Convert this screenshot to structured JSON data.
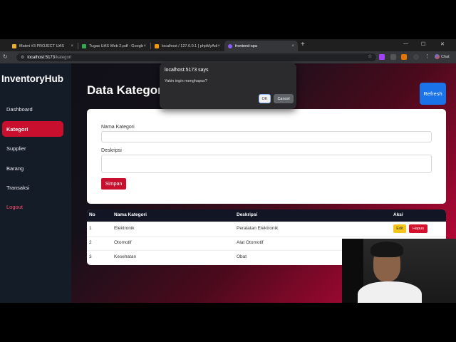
{
  "browser": {
    "tabs": [
      {
        "label": "Materi #3 PROJECT UAS",
        "active": false,
        "color": "#e8b12a"
      },
      {
        "label": "Tugas UAS Web 2.pdf - Google D",
        "active": false,
        "color": "#34a853"
      },
      {
        "label": "localhost / 127.0.0.1 | phpMyAdmi",
        "active": false,
        "color": "#f29900"
      },
      {
        "label": "frontend-spa",
        "active": true,
        "color": "#8b5cf6"
      }
    ],
    "new_tab": "+",
    "url_host": "localhost:5173",
    "url_path": "/kategori",
    "chat_label": "Chat"
  },
  "sidebar": {
    "brand": "InventoryHub",
    "items": [
      {
        "label": "Dashboard",
        "active": false
      },
      {
        "label": "Kategori",
        "active": true
      },
      {
        "label": "Supplier",
        "active": false
      },
      {
        "label": "Barang",
        "active": false
      },
      {
        "label": "Transaksi",
        "active": false
      },
      {
        "label": "Logout",
        "active": false
      }
    ]
  },
  "main": {
    "title": "Data Kategori",
    "refresh_label": "Refresh",
    "form": {
      "name_label": "Nama Kategori",
      "name_value": "",
      "desc_label": "Deskripsi",
      "desc_value": "",
      "save_label": "Simpan"
    },
    "table": {
      "headers": [
        "No",
        "Nama Kategori",
        "Deskripsi",
        "Aksi"
      ],
      "rows": [
        {
          "no": "1",
          "name": "Elektronik",
          "desc": "Peralatan Elektronik"
        },
        {
          "no": "2",
          "name": "Otomotif",
          "desc": "Alat Otomotif"
        },
        {
          "no": "3",
          "name": "Kesehatan",
          "desc": "Obat"
        }
      ],
      "edit_label": "Edit",
      "delete_label": "Hapus"
    }
  },
  "dialog": {
    "title": "localhost:5173 says",
    "message": "Yakin ingin menghapus?",
    "ok_label": "OK",
    "cancel_label": "Cancel"
  },
  "colors": {
    "accent": "#c8102e",
    "refresh": "#1a73e8",
    "edit": "#f5c518",
    "delete": "#d5102d"
  }
}
